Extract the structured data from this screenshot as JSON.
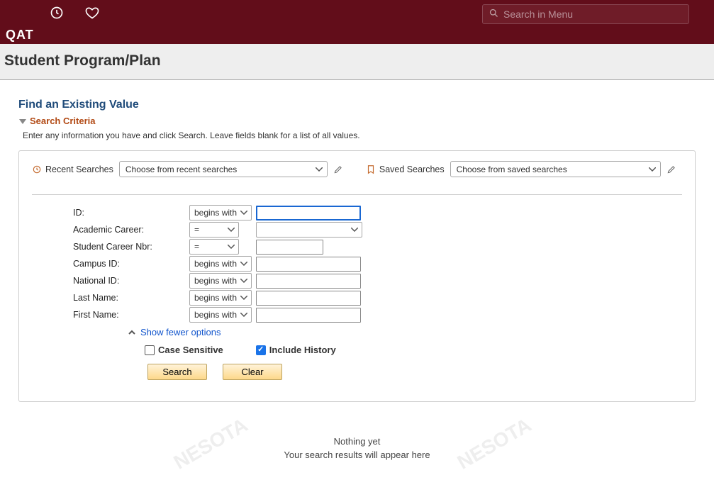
{
  "header": {
    "brand": "QAT",
    "search_placeholder": "Search in Menu"
  },
  "page_title": "Student Program/Plan",
  "section": {
    "find_title": "Find an Existing Value",
    "criteria_label": "Search Criteria",
    "instructions": "Enter any information you have and click Search. Leave fields blank for a list of all values."
  },
  "saved_searches": {
    "recent_label": "Recent Searches",
    "recent_placeholder": "Choose from recent searches",
    "saved_label": "Saved Searches",
    "saved_placeholder": "Choose from saved searches"
  },
  "fields": {
    "id": {
      "label": "ID:",
      "op": "begins with",
      "value": ""
    },
    "career": {
      "label": "Academic Career:",
      "op": "=",
      "value": ""
    },
    "career_nbr": {
      "label": "Student Career Nbr:",
      "op": "=",
      "value": ""
    },
    "campus": {
      "label": "Campus ID:",
      "op": "begins with",
      "value": ""
    },
    "national": {
      "label": "National ID:",
      "op": "begins with",
      "value": ""
    },
    "last": {
      "label": "Last Name:",
      "op": "begins with",
      "value": ""
    },
    "first": {
      "label": "First Name:",
      "op": "begins with",
      "value": ""
    }
  },
  "toggles": {
    "show_fewer": "Show fewer options",
    "case_sensitive_label": "Case Sensitive",
    "case_sensitive_checked": false,
    "include_history_label": "Include History",
    "include_history_checked": true
  },
  "buttons": {
    "search": "Search",
    "clear": "Clear"
  },
  "results": {
    "line1": "Nothing yet",
    "line2": "Your search results will appear here"
  }
}
